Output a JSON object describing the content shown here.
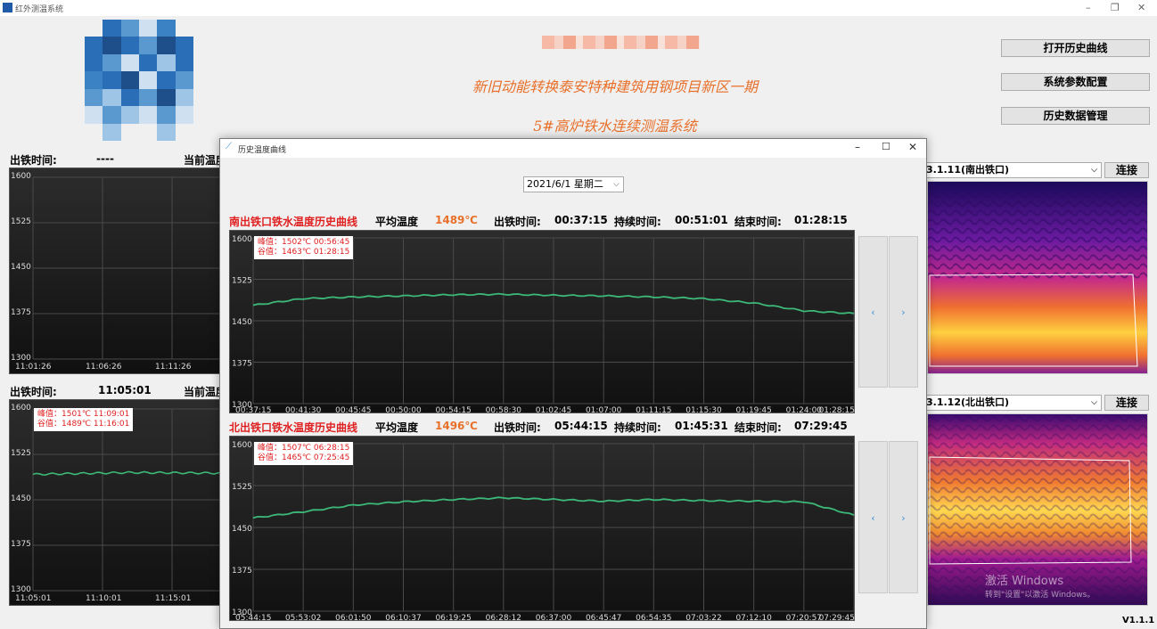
{
  "app": {
    "title": "红外测温系统",
    "version": "V1.1.1"
  },
  "header": {
    "project": "新旧动能转换泰安特种建筑用钢项目新区一期",
    "system": "5#高炉铁水连续测温系统"
  },
  "buttons": {
    "history_curve": "打开历史曲线",
    "params": "系统参数配置",
    "data_mgmt": "历史数据管理",
    "connect": "连接"
  },
  "main_top": {
    "tap_time_label": "出铁时间:",
    "tap_time_value": "----",
    "current_temp_label": "当前温度",
    "y_ticks": [
      "1600",
      "1525",
      "1450",
      "1375",
      "1300"
    ],
    "x_ticks": [
      "11:01:26",
      "11:06:26",
      "11:11:26"
    ]
  },
  "main_bottom": {
    "tap_time_label": "出铁时间:",
    "tap_time_value": "11:05:01",
    "current_temp_label": "当前温度",
    "peak": "峰值：1501℃ 11:09:01",
    "valley": "谷值：1489℃ 11:16:01",
    "y_ticks": [
      "1600",
      "1525",
      "1450",
      "1375",
      "1300"
    ],
    "x_ticks": [
      "11:05:01",
      "11:10:01",
      "11:15:01"
    ]
  },
  "cameras": [
    {
      "label": "3.1.11(南出铁口)"
    },
    {
      "label": "3.1.12(北出铁口)"
    }
  ],
  "watermark": {
    "line1": "激活 Windows",
    "line2": "转到\"设置\"以激活 Windows。"
  },
  "dialog": {
    "title": "历史温度曲线",
    "date": "2021/6/1 星期二",
    "south": {
      "title": "南出铁口铁水温度历史曲线",
      "avg_label": "平均温度",
      "avg_value": "1489℃",
      "tap_label": "出铁时间:",
      "tap_value": "00:37:15",
      "dur_label": "持续时间:",
      "dur_value": "00:51:01",
      "end_label": "结束时间:",
      "end_value": "01:28:15",
      "peak": "峰值：1502℃ 00:56:45",
      "valley": "谷值：1463℃ 01:28:15",
      "y_ticks": [
        "1600",
        "1525",
        "1450",
        "1375",
        "1300"
      ],
      "x_ticks": [
        "00:37:15",
        "00:41:30",
        "00:45:45",
        "00:50:00",
        "00:54:15",
        "00:58:30",
        "01:02:45",
        "01:07:00",
        "01:11:15",
        "01:15:30",
        "01:19:45",
        "01:24:00",
        "01:28:15"
      ]
    },
    "north": {
      "title": "北出铁口铁水温度历史曲线",
      "avg_label": "平均温度",
      "avg_value": "1496℃",
      "tap_label": "出铁时间:",
      "tap_value": "05:44:15",
      "dur_label": "持续时间:",
      "dur_value": "01:45:31",
      "end_label": "结束时间:",
      "end_value": "07:29:45",
      "peak": "峰值：1507℃ 06:28:15",
      "valley": "谷值：1465℃ 07:25:45",
      "y_ticks": [
        "1600",
        "1525",
        "1450",
        "1375",
        "1300"
      ],
      "x_ticks": [
        "05:44:15",
        "05:53:02",
        "06:01:50",
        "06:10:37",
        "06:19:25",
        "06:28:12",
        "06:37:00",
        "06:45:47",
        "06:54:35",
        "07:03:22",
        "07:12:10",
        "07:20:57",
        "07:29:45"
      ]
    },
    "nav": {
      "prev": "‹",
      "next": "›"
    }
  },
  "chart_data": [
    {
      "type": "line",
      "name": "南出铁口铁水温度历史曲线",
      "ylim": [
        1300,
        1600
      ],
      "x": [
        "00:37:15",
        "00:41:30",
        "00:45:45",
        "00:50:00",
        "00:54:15",
        "00:58:30",
        "01:02:45",
        "01:07:00",
        "01:11:15",
        "01:15:30",
        "01:19:45",
        "01:24:00",
        "01:28:15"
      ],
      "values": [
        1478,
        1490,
        1493,
        1495,
        1497,
        1498,
        1496,
        1495,
        1493,
        1490,
        1482,
        1468,
        1463
      ]
    },
    {
      "type": "line",
      "name": "北出铁口铁水温度历史曲线",
      "ylim": [
        1300,
        1600
      ],
      "x": [
        "05:44:15",
        "05:53:02",
        "06:01:50",
        "06:10:37",
        "06:19:25",
        "06:28:12",
        "06:37:00",
        "06:45:47",
        "06:54:35",
        "07:03:22",
        "07:12:10",
        "07:20:57",
        "07:29:45"
      ],
      "values": [
        1467,
        1478,
        1490,
        1496,
        1500,
        1503,
        1500,
        1497,
        1500,
        1498,
        1497,
        1496,
        1472
      ]
    },
    {
      "type": "line",
      "name": "main-bottom",
      "ylim": [
        1300,
        1600
      ],
      "x": [
        "11:05:01",
        "11:10:01",
        "11:15:01"
      ],
      "values": [
        1492,
        1495,
        1494
      ]
    }
  ]
}
